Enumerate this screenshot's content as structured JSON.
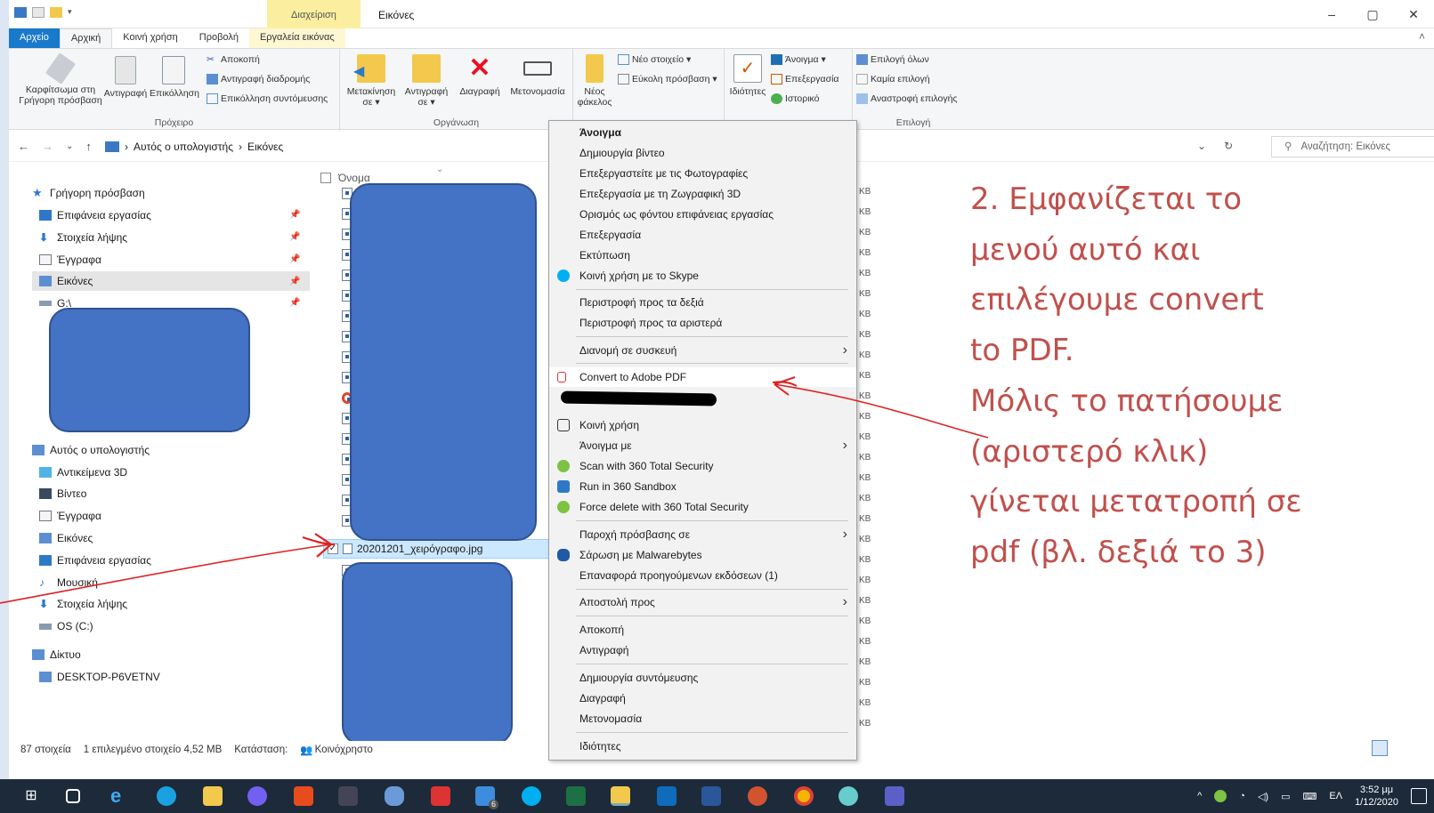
{
  "window": {
    "context_tab_header": "Διαχείριση",
    "title": "Εικόνες",
    "controls": [
      "–",
      "▢",
      "✕"
    ]
  },
  "ribbon_tabs": [
    {
      "label": "Αρχείο"
    },
    {
      "label": "Αρχική"
    },
    {
      "label": "Κοινή χρήση"
    },
    {
      "label": "Προβολή"
    },
    {
      "label": "Εργαλεία εικόνας"
    }
  ],
  "ribbon": {
    "clipboard": {
      "pin": "Καρφίτσωμα στη Γρήγορη πρόσβαση",
      "copy": "Αντιγραφή",
      "paste": "Επικόλληση",
      "cut": "Αποκοπή",
      "copy_path": "Αντιγραφή διαδρομής",
      "paste_shortcut": "Επικόλληση συντόμευσης",
      "group": "Πρόχειρο"
    },
    "organize": {
      "move": "Μετακίνηση σε ▾",
      "copy_to": "Αντιγραφή σε ▾",
      "delete": "Διαγραφή",
      "rename": "Μετονομασία",
      "group": "Οργάνωση"
    },
    "new": {
      "folder": "Νέος φάκελος",
      "new_item": "Νέο στοιχείο ▾",
      "easy_access": "Εύκολη πρόσβαση ▾"
    },
    "open": {
      "properties": "Ιδιότητες",
      "open": "Άνοιγμα ▾",
      "edit": "Επεξεργασία",
      "history": "Ιστορικό"
    },
    "select": {
      "select_all": "Επιλογή όλων",
      "select_none": "Καμία επιλογή",
      "invert": "Αναστροφή επιλογής",
      "group": "Επιλογή"
    }
  },
  "address": {
    "crumb1": "Αυτός ο υπολογιστής",
    "sep": "›",
    "crumb2": "Εικόνες",
    "search_placeholder": "Αναζήτηση: Εικόνες"
  },
  "nav": {
    "quick_access": "Γρήγορη πρόσβαση",
    "desktop": "Επιφάνεια εργασίας",
    "downloads": "Στοιχεία λήψης",
    "documents": "Έγγραφα",
    "pictures": "Εικόνες",
    "drive_g": "G:\\",
    "this_pc": "Αυτός ο υπολογιστής",
    "objects3d": "Αντικείμενα 3D",
    "videos": "Βίντεο",
    "documents2": "Έγγραφα",
    "pictures2": "Εικόνες",
    "desktop2": "Επιφάνεια εργασίας",
    "music": "Μουσική",
    "downloads2": "Στοιχεία λήψης",
    "os_c": "OS (C:)",
    "network": "Δίκτυο",
    "desktop_pc": "DESKTOP-P6VETNV"
  },
  "files": {
    "column_name": "Όνομα",
    "selected_file": "20201201_χειρόγραφο.jpg",
    "size_unit": "KB"
  },
  "context_menu": [
    {
      "label": "Άνοιγμα",
      "bold": true
    },
    {
      "label": "Δημιουργία βίντεο"
    },
    {
      "label": "Επεξεργαστείτε με τις Φωτογραφίες"
    },
    {
      "label": "Επεξεργασία με τη Ζωγραφική 3D"
    },
    {
      "label": "Ορισμός ως φόντου επιφάνειας εργασίας"
    },
    {
      "label": "Επεξεργασία"
    },
    {
      "label": "Εκτύπωση"
    },
    {
      "label": "Κοινή χρήση με το Skype"
    },
    {
      "label": "Περιστροφή προς τα δεξιά"
    },
    {
      "label": "Περιστροφή προς τα αριστερά"
    },
    {
      "label": "Διανομή σε συσκευή"
    },
    {
      "label": "Convert to Adobe PDF"
    },
    {
      "label": "Κοινή χρήση"
    },
    {
      "label": "Άνοιγμα με"
    },
    {
      "label": "Scan with 360 Total Security"
    },
    {
      "label": "Run in 360 Sandbox"
    },
    {
      "label": "Force delete with 360 Total Security"
    },
    {
      "label": "Παροχή πρόσβασης σε"
    },
    {
      "label": "Σάρωση με Malwarebytes"
    },
    {
      "label": "Επαναφορά προηγούμενων εκδόσεων (1)"
    },
    {
      "label": "Αποστολή προς"
    },
    {
      "label": "Αποκοπή"
    },
    {
      "label": "Αντιγραφή"
    },
    {
      "label": "Δημιουργία συντόμευσης"
    },
    {
      "label": "Διαγραφή"
    },
    {
      "label": "Μετονομασία"
    },
    {
      "label": "Ιδιότητες"
    }
  ],
  "status": {
    "count": "87 στοιχεία",
    "selected": "1 επιλεγμένο στοιχείο 4,52 MB",
    "state": "Κατάσταση:",
    "shared": "Κοινόχρηστο"
  },
  "annotation": {
    "lines": [
      "2. Εμφανίζεται το",
      "μενού αυτό και",
      "επιλέγουμε convert",
      "to PDF.",
      "Μόλις το πατήσουμε",
      "(αριστερό κλικ)",
      "γίνεται μετατροπή σε",
      "pdf  (βλ. δεξιά το 3)"
    ],
    "color": "#c0504d"
  },
  "taskbar": {
    "lang": "ΕΛ",
    "time": "3:52 μμ",
    "date": "1/12/2020",
    "badge": "6"
  }
}
